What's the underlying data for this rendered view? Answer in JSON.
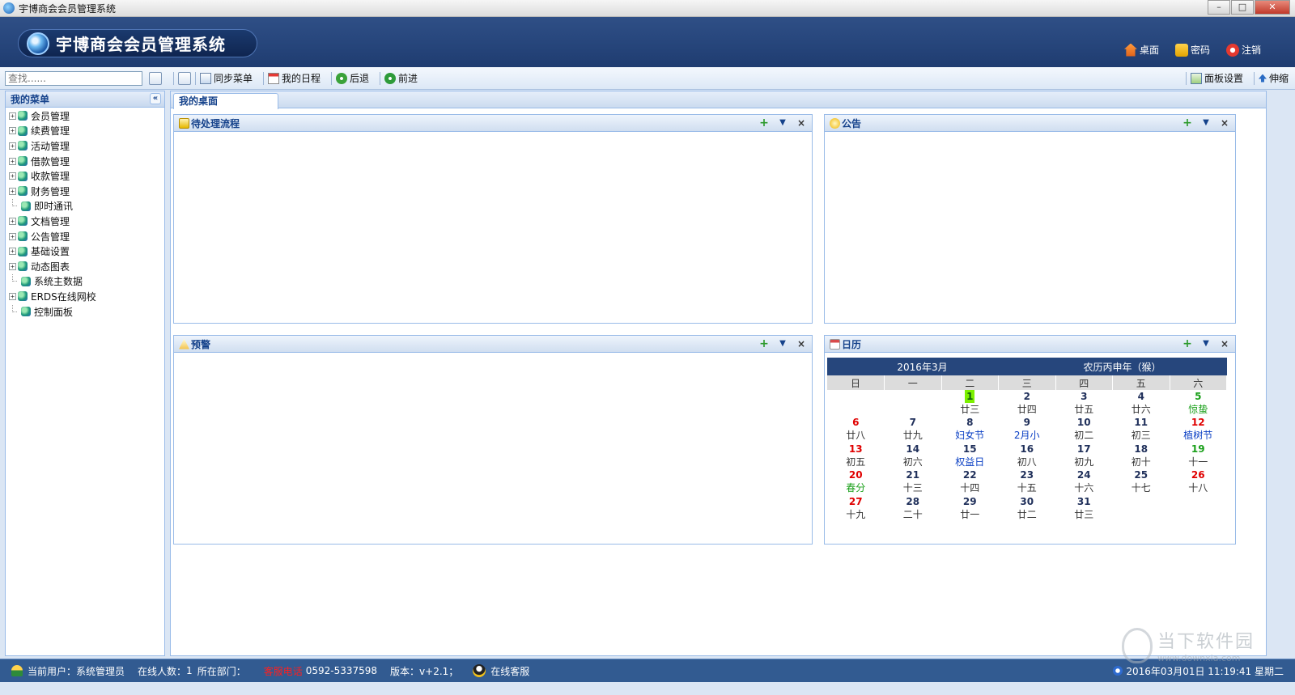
{
  "window": {
    "title": "宇博商会会员管理系统"
  },
  "header": {
    "logo_text": "宇博商会会员管理系统",
    "links": [
      {
        "label": "桌面",
        "icon": "home-icon"
      },
      {
        "label": "密码",
        "icon": "lock-icon"
      },
      {
        "label": "注销",
        "icon": "power-icon"
      }
    ]
  },
  "toolbar": {
    "search_placeholder": "查找......",
    "buttons": [
      {
        "label": "同步菜单",
        "icon": "sync-icon"
      },
      {
        "label": "我的日程",
        "icon": "schedule-icon"
      },
      {
        "label": "后退",
        "icon": "back-icon"
      },
      {
        "label": "前进",
        "icon": "forward-icon"
      }
    ],
    "right_buttons": [
      {
        "label": "面板设置",
        "icon": "panel-settings-icon"
      },
      {
        "label": "伸缩",
        "icon": "collapse-icon"
      }
    ]
  },
  "sidebar": {
    "title": "我的菜单",
    "collapse_glyph": "«",
    "items": [
      {
        "label": "会员管理",
        "expandable": true
      },
      {
        "label": "续费管理",
        "expandable": true
      },
      {
        "label": "活动管理",
        "expandable": true
      },
      {
        "label": "借款管理",
        "expandable": true
      },
      {
        "label": "收款管理",
        "expandable": true
      },
      {
        "label": "财务管理",
        "expandable": true
      },
      {
        "label": "即时通讯",
        "expandable": false
      },
      {
        "label": "文档管理",
        "expandable": true
      },
      {
        "label": "公告管理",
        "expandable": true
      },
      {
        "label": "基础设置",
        "expandable": true
      },
      {
        "label": "动态图表",
        "expandable": true
      },
      {
        "label": "系统主数据",
        "expandable": false
      },
      {
        "label": "ERDS在线网校",
        "expandable": true
      },
      {
        "label": "控制面板",
        "expandable": false
      }
    ]
  },
  "main": {
    "tab": "我的桌面",
    "portlets": {
      "pending": "待处理流程",
      "notice": "公告",
      "warning": "预警",
      "calendar": "日历"
    }
  },
  "calendar": {
    "month": "2016年3月",
    "lunar_year": "农历丙申年（猴）",
    "weekdays": [
      "日",
      "一",
      "二",
      "三",
      "四",
      "五",
      "六"
    ],
    "weeks": [
      [
        null,
        null,
        {
          "d": "1",
          "l": "廿三",
          "today": true
        },
        {
          "d": "2",
          "l": "廿四"
        },
        {
          "d": "3",
          "l": "廿五"
        },
        {
          "d": "4",
          "l": "廿六"
        },
        {
          "d": "5",
          "l": "惊蛰",
          "dc": "green",
          "lc": "green"
        }
      ],
      [
        {
          "d": "6",
          "l": "廿八",
          "dc": "red"
        },
        {
          "d": "7",
          "l": "廿九"
        },
        {
          "d": "8",
          "l": "妇女节",
          "lc": "blue"
        },
        {
          "d": "9",
          "l": "2月小",
          "lc": "blue"
        },
        {
          "d": "10",
          "l": "初二"
        },
        {
          "d": "11",
          "l": "初三"
        },
        {
          "d": "12",
          "l": "植树节",
          "dc": "red",
          "lc": "blue"
        }
      ],
      [
        {
          "d": "13",
          "l": "初五",
          "dc": "red"
        },
        {
          "d": "14",
          "l": "初六"
        },
        {
          "d": "15",
          "l": "权益日",
          "lc": "blue"
        },
        {
          "d": "16",
          "l": "初八"
        },
        {
          "d": "17",
          "l": "初九"
        },
        {
          "d": "18",
          "l": "初十"
        },
        {
          "d": "19",
          "l": "十一",
          "dc": "green"
        }
      ],
      [
        {
          "d": "20",
          "l": "春分",
          "dc": "red",
          "lc": "green"
        },
        {
          "d": "21",
          "l": "十三"
        },
        {
          "d": "22",
          "l": "十四"
        },
        {
          "d": "23",
          "l": "十五"
        },
        {
          "d": "24",
          "l": "十六"
        },
        {
          "d": "25",
          "l": "十七"
        },
        {
          "d": "26",
          "l": "十八",
          "dc": "red"
        }
      ],
      [
        {
          "d": "27",
          "l": "十九",
          "dc": "red"
        },
        {
          "d": "28",
          "l": "二十"
        },
        {
          "d": "29",
          "l": "廿一"
        },
        {
          "d": "30",
          "l": "廿二"
        },
        {
          "d": "31",
          "l": "廿三"
        },
        null,
        null
      ]
    ]
  },
  "status": {
    "current_user_label": "当前用户：",
    "current_user": "系统管理员",
    "online_label": "在线人数：",
    "online_count": "1",
    "dept_label": "所在部门：",
    "hotline_label": "客服电话",
    "hotline": "0592-5337598",
    "version_label": "版本：",
    "version": "v+2.1；",
    "online_service": "在线客服",
    "datetime": "2016年03月01日 11:19:41 星期二"
  },
  "watermark": {
    "text": "当下软件园",
    "url": "www.downxia.com"
  },
  "colors": {
    "header_bg": "#27467c",
    "panel_border": "#99bbe8",
    "status_bg": "#325b91",
    "today_bg": "#7cf000"
  }
}
